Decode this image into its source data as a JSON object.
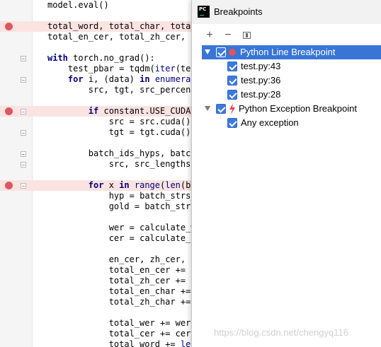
{
  "editor": {
    "lines": [
      {
        "text": "model.eval()",
        "breakpoint": false,
        "fold": false
      },
      {
        "text": "",
        "breakpoint": false,
        "fold": false
      },
      {
        "text": "total_word, total_char, total",
        "breakpoint": true,
        "fold": false
      },
      {
        "text": "total_en_cer, total_zh_cer, t",
        "breakpoint": false,
        "fold": false
      },
      {
        "text": "",
        "breakpoint": false,
        "fold": false
      },
      {
        "text": "with torch.no_grad():",
        "breakpoint": false,
        "fold": true
      },
      {
        "text": "    test_pbar = tqdm(iter(tes",
        "breakpoint": false,
        "fold": false
      },
      {
        "text": "    for i, (data) in enumerat",
        "breakpoint": false,
        "fold": true
      },
      {
        "text": "        src, tgt, src_percent",
        "breakpoint": false,
        "fold": false
      },
      {
        "text": "",
        "breakpoint": false,
        "fold": false
      },
      {
        "text": "        if constant.USE_CUDA:",
        "breakpoint": true,
        "fold": true
      },
      {
        "text": "            src = src.cuda()",
        "breakpoint": false,
        "fold": false
      },
      {
        "text": "            tgt = tgt.cuda()",
        "breakpoint": false,
        "fold": true
      },
      {
        "text": "",
        "breakpoint": false,
        "fold": false
      },
      {
        "text": "        batch_ids_hyps, batch",
        "breakpoint": false,
        "fold": true
      },
      {
        "text": "            src, src_lengths,",
        "breakpoint": false,
        "fold": true
      },
      {
        "text": "",
        "breakpoint": false,
        "fold": false
      },
      {
        "text": "        for x in range(len(ba",
        "breakpoint": true,
        "fold": true
      },
      {
        "text": "            hyp = batch_strs_",
        "breakpoint": false,
        "fold": false
      },
      {
        "text": "            gold = batch_strs",
        "breakpoint": false,
        "fold": false
      },
      {
        "text": "",
        "breakpoint": false,
        "fold": false
      },
      {
        "text": "            wer = calculate_w",
        "breakpoint": false,
        "fold": false
      },
      {
        "text": "            cer = calculate_c",
        "breakpoint": false,
        "fold": false
      },
      {
        "text": "",
        "breakpoint": false,
        "fold": false
      },
      {
        "text": "            en_cer, zh_cer, n",
        "breakpoint": false,
        "fold": false
      },
      {
        "text": "            total_en_cer += e",
        "breakpoint": false,
        "fold": false
      },
      {
        "text": "            total_zh_cer += z",
        "breakpoint": false,
        "fold": false
      },
      {
        "text": "            total_en_char +=",
        "breakpoint": false,
        "fold": false
      },
      {
        "text": "            total_zh_char +=",
        "breakpoint": false,
        "fold": false
      },
      {
        "text": "",
        "breakpoint": false,
        "fold": false
      },
      {
        "text": "            total_wer += wer",
        "breakpoint": false,
        "fold": false
      },
      {
        "text": "            total_cer += cer",
        "breakpoint": false,
        "fold": false
      },
      {
        "text": "            total_word += len",
        "breakpoint": false,
        "fold": false
      }
    ],
    "keywords": [
      "with",
      "for",
      "in",
      "if"
    ],
    "builtins": [
      "range",
      "len",
      "iter",
      "enumerat"
    ]
  },
  "popup": {
    "icon_text": "PC",
    "title": "Breakpoints",
    "toolbar": {
      "add_icon": "+",
      "remove_icon": "−"
    },
    "tree": [
      {
        "label": "Python Line Breakpoint",
        "level": 0,
        "expanded": true,
        "checked": true,
        "icon": "red-dot-icon",
        "selected": true
      },
      {
        "label": "test.py:43",
        "level": 1,
        "checked": true,
        "selected": false
      },
      {
        "label": "test.py:36",
        "level": 1,
        "checked": true,
        "selected": false
      },
      {
        "label": "test.py:28",
        "level": 1,
        "checked": true,
        "selected": false
      },
      {
        "label": "Python Exception Breakpoint",
        "level": 0,
        "expanded": true,
        "checked": true,
        "icon": "lightning-icon",
        "selected": false
      },
      {
        "label": "Any exception",
        "level": 1,
        "checked": true,
        "selected": false
      }
    ]
  },
  "watermark": "https://blog.csdn.net/chengyq116",
  "colors": {
    "breakpoint": "#db5860",
    "breakpoint_line_bg": "#fae3e1",
    "selection": "#3875d7",
    "keyword": "#000080"
  }
}
